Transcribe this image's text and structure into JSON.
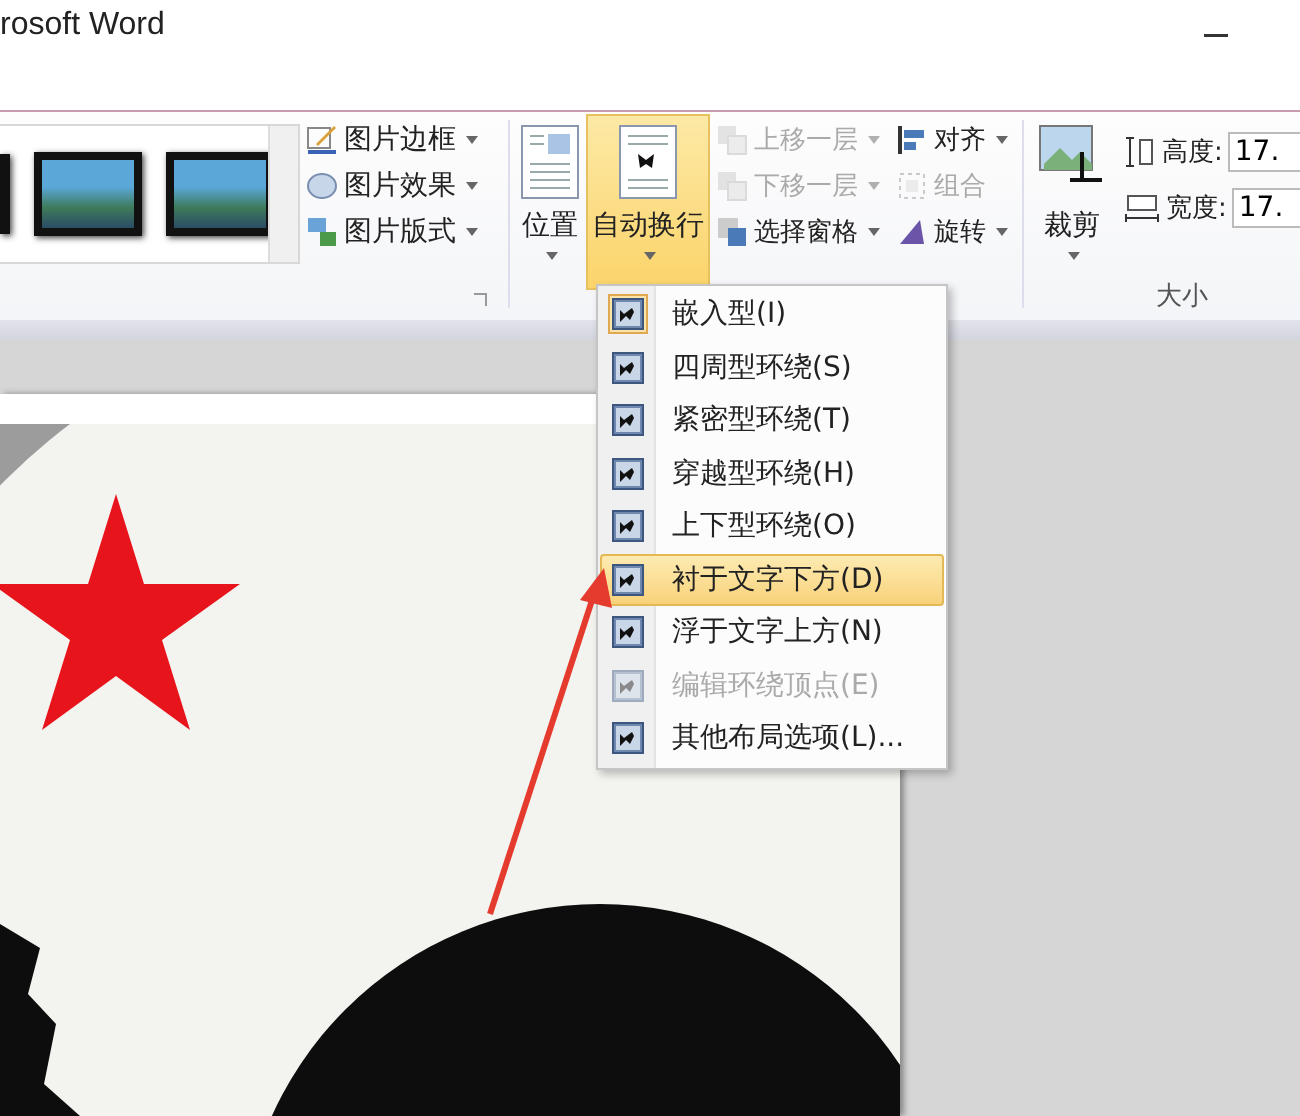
{
  "window": {
    "title": "rosoft Word"
  },
  "ribbon": {
    "picture_commands": [
      {
        "label": "图片边框"
      },
      {
        "label": "图片效果"
      },
      {
        "label": "图片版式"
      }
    ],
    "position_button": {
      "label": "位置"
    },
    "wrap_button": {
      "label": "自动换行",
      "expanded": true
    },
    "arrange_commands": [
      {
        "label": "上移一层",
        "disabled": true
      },
      {
        "label": "对齐",
        "disabled": false
      },
      {
        "label": "下移一层",
        "disabled": true
      },
      {
        "label": "组合",
        "disabled": true
      },
      {
        "label": "选择窗格",
        "disabled": false
      },
      {
        "label": "旋转",
        "disabled": false
      }
    ],
    "crop_button": {
      "label": "裁剪"
    },
    "size": {
      "height_label": "高度:",
      "height_value": "17.",
      "width_label": "宽度:",
      "width_value": "17.",
      "group_label": "大小"
    }
  },
  "wrap_menu": [
    {
      "label": "嵌入型(I)",
      "selected": false,
      "disabled": false,
      "current": true
    },
    {
      "label": "四周型环绕(S)",
      "selected": false,
      "disabled": false,
      "current": false
    },
    {
      "label": "紧密型环绕(T)",
      "selected": false,
      "disabled": false,
      "current": false
    },
    {
      "label": "穿越型环绕(H)",
      "selected": false,
      "disabled": false,
      "current": false
    },
    {
      "label": "上下型环绕(O)",
      "selected": false,
      "disabled": false,
      "current": false
    },
    {
      "label": "衬于文字下方(D)",
      "selected": true,
      "disabled": false,
      "current": false
    },
    {
      "label": "浮于文字上方(N)",
      "selected": false,
      "disabled": false,
      "current": false
    },
    {
      "label": "编辑环绕顶点(E)",
      "selected": false,
      "disabled": true,
      "current": false
    },
    {
      "label": "其他布局选项(L)...",
      "selected": false,
      "disabled": false,
      "current": false
    }
  ]
}
